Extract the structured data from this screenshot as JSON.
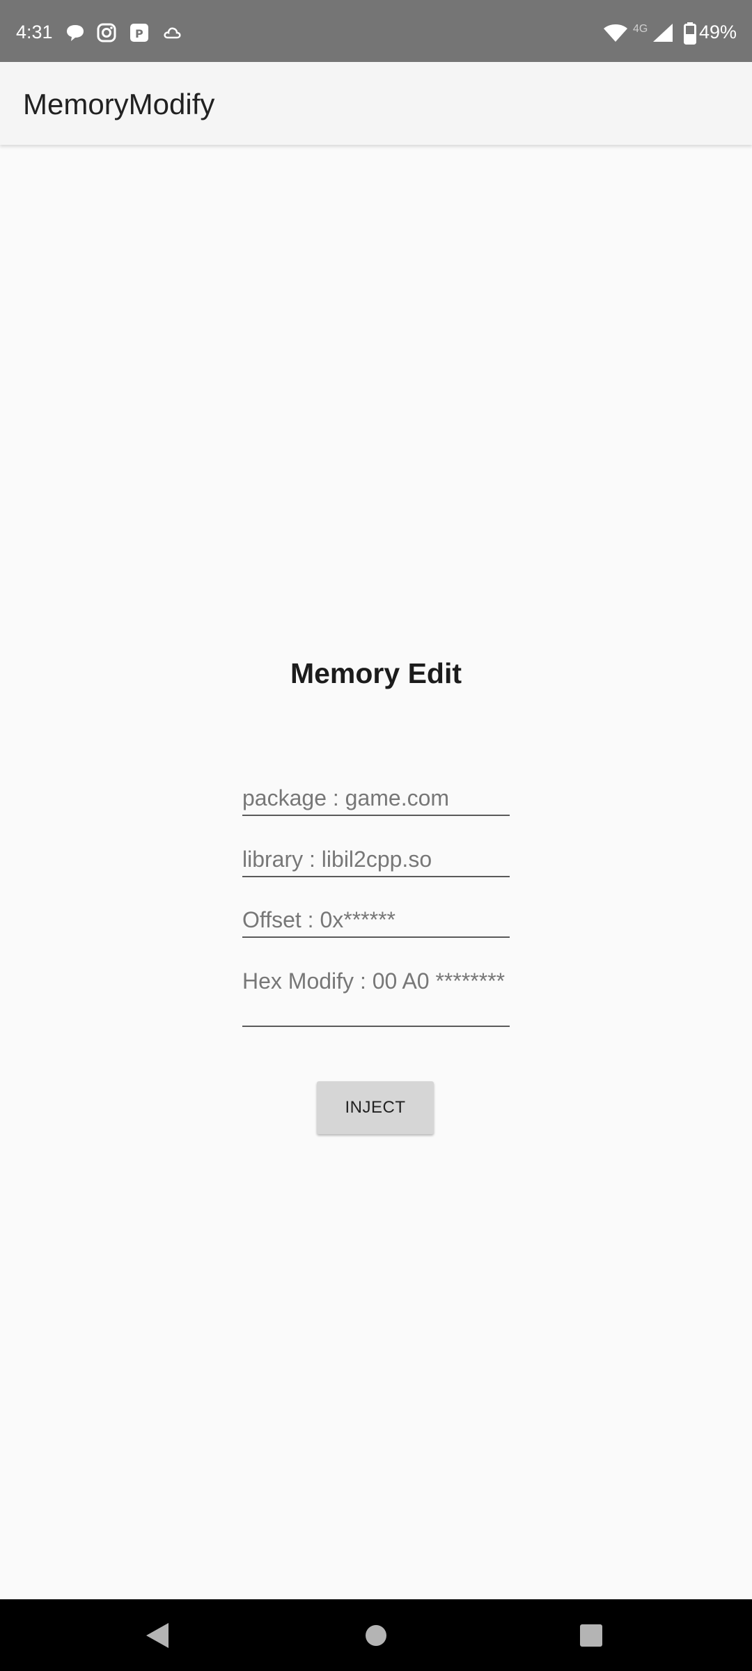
{
  "status_bar": {
    "time": "4:31",
    "notification_icons": [
      "chat-bubble-icon",
      "instagram-icon",
      "parking-app-icon",
      "cloud-icon"
    ],
    "network_type": "4G",
    "battery": "49%",
    "background_color": "#757575"
  },
  "app_bar": {
    "title": "MemoryModify"
  },
  "main": {
    "heading": "Memory Edit",
    "fields": [
      {
        "name": "package",
        "hint": "package : game.com"
      },
      {
        "name": "library",
        "hint": "library : libil2cpp.so"
      },
      {
        "name": "offset",
        "hint": "Offset : 0x******"
      },
      {
        "name": "hex",
        "hint": "Hex Modify : 00 A0 ********"
      }
    ],
    "inject_label": "INJECT"
  },
  "nav_bar": {
    "buttons": [
      "back-icon",
      "home-icon",
      "recents-icon"
    ]
  }
}
